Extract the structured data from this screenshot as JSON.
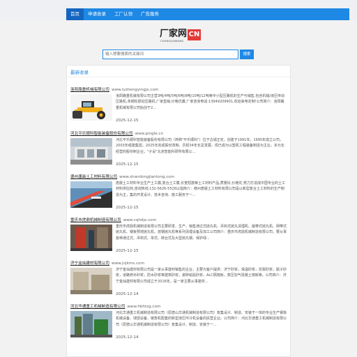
{
  "nav": {
    "items": [
      {
        "label": "首页",
        "active": true
      },
      {
        "label": "申请收录",
        "active": false
      },
      {
        "label": "工厂认领",
        "active": false
      },
      {
        "label": "广告服务",
        "active": false
      }
    ]
  },
  "logo": {
    "text": "厂家网",
    "badge": "CN",
    "subtitle": "CHANGJIAWANG"
  },
  "search": {
    "placeholder": "输入想要搜索的关键词",
    "button_label": "搜索"
  },
  "panel": {
    "title": "最新收录"
  },
  "entries": [
    {
      "name": "洛阳路重机械有限公司",
      "url": "www.lyzhengyingjx.com",
      "desc": "洛阳路重机械有限公司主营3吨/4吨/5吨/6吨/8吨/10吨/12吨等中小型压路机的生产与销售,包含机械/液压传动压路机,单钢轮振动压路机,厂家直销,价格优廉,厂家咨询电话:13949209901,欢迎来电定制!公司简介：洛阳路重机械有限公司始创于2...",
      "date": "2025-12-15"
    },
    {
      "name": "河北平乐顺科智能装备股份有限公司",
      "url": "www.pingle.cn",
      "desc": "河北平乐顺科智能装备股份有限公司（简称\"平乐顺科\"）位于古城正定，创建于1991年，1995年成立公司，2003年组建集团，2025年完成股份改制，历经34年长足发展，现已成为以塑机工程装备制造为主业，多元化经营的股份制企业，\"子设\"北京智能科研所有限公...",
      "date": "2025-12-15"
    },
    {
      "name": "德州唐晨土工材料有限公司",
      "url": "www.shandongjiantong.com",
      "desc": "唐晨土工材料专业生产土工膜,复合土工膜,长宽短筋等土工材料产品,质量好,价格优,努力打造成中国专业的土工材料供应商,咨询热线:132-5626-5526以指简介：德州唐晨土工材料有限公司是以新型复合土工材料的生产制造为主，集的开发设计、技术咨询、施工服务于一...",
      "date": "2025-12-15"
    },
    {
      "name": "重庆市虎鼎机械制造有限公司",
      "url": "www.cqhdjx.com",
      "desc": "重庆市虎鼎机械制造有限公司主要研发、生产、销售通过式抛丸机、吊钩式抛丸清理机、履带式抛丸机、网带式抛丸机、钢板预增抛丸机、放钢抛丸机等系列清理设备及加工公司简介：重庆市虎鼎机械制造有限公司，要从事各种通过式、吊钩式、单式、转台式及大型抛丸钢、保护绿...",
      "date": "2025-12-15"
    },
    {
      "name": "济宁金灿建材有限公司",
      "url": "www.jnjkms.com",
      "desc": "济宁金灿建材有限公司是一家从事建材销售的企业，主要为客户提供：济宁砂浆，保温砂浆，抗裂砂浆，腻子砂浆，道路修补砂浆，防水砂浆等建筑砂浆，瓷砖粘贴砂浆，ALC隔墙板，蒸压加气混凝土墙板等。公司简介：济宁金灿建材有限公司成立于2016年，是一家主要从事建材...",
      "date": "2025-12-14"
    },
    {
      "name": "河北华通重工机械制造有限公司",
      "url": "www.hbhtzg.com",
      "desc": "河北华通重工机械制造有限公司（原唐山华通机械制造有限公司）复集设计、制造、安装于一体的专业生产钢铁机械设备、球团设备、链箅机配套的新型液压环冷机设备的民营企业。公司简介：河北华通重工机械制造有限公司（原唐山华通机械制造有限公司）复集设计、制造、安装于一...",
      "date": "2025-12-14"
    }
  ],
  "colors": {
    "accent": "#1e88e5",
    "badge": "#e53935"
  }
}
